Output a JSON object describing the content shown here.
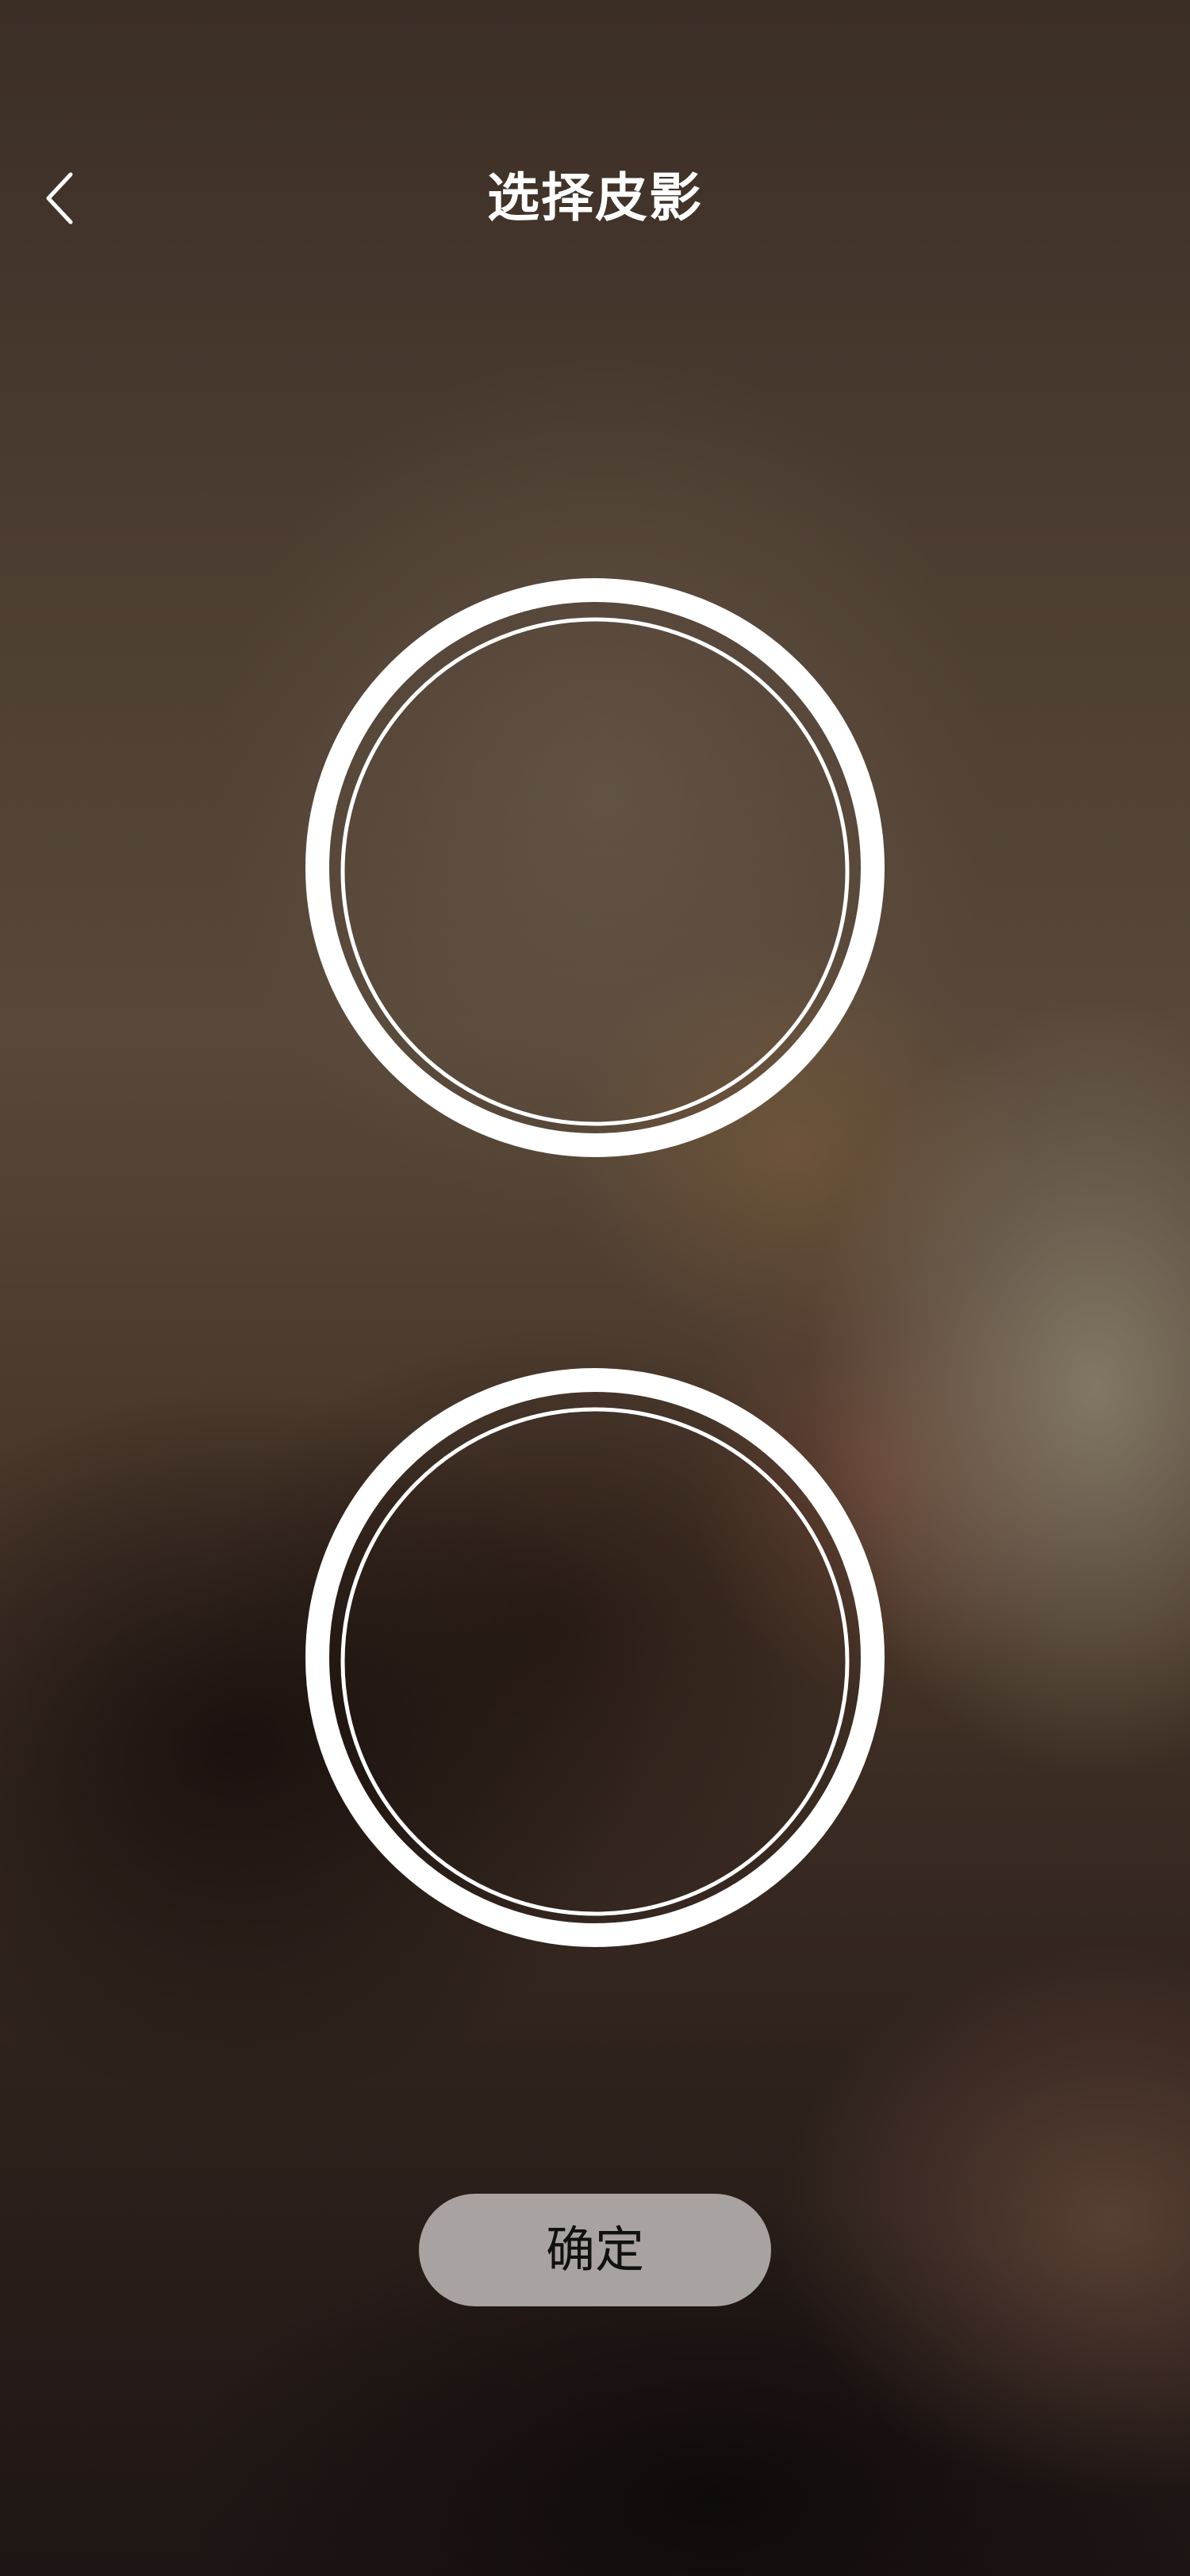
{
  "header": {
    "title": "选择皮影",
    "back_icon": "chevron-left-icon"
  },
  "slots": [
    {
      "icon": "empty-selection-circle-icon"
    },
    {
      "icon": "empty-selection-circle-icon"
    }
  ],
  "footer": {
    "confirm_label": "确定"
  },
  "colors": {
    "title": "#ffffff",
    "button_bg": "#a8a3a0",
    "button_text": "#111111",
    "ring": "#ffffff"
  }
}
